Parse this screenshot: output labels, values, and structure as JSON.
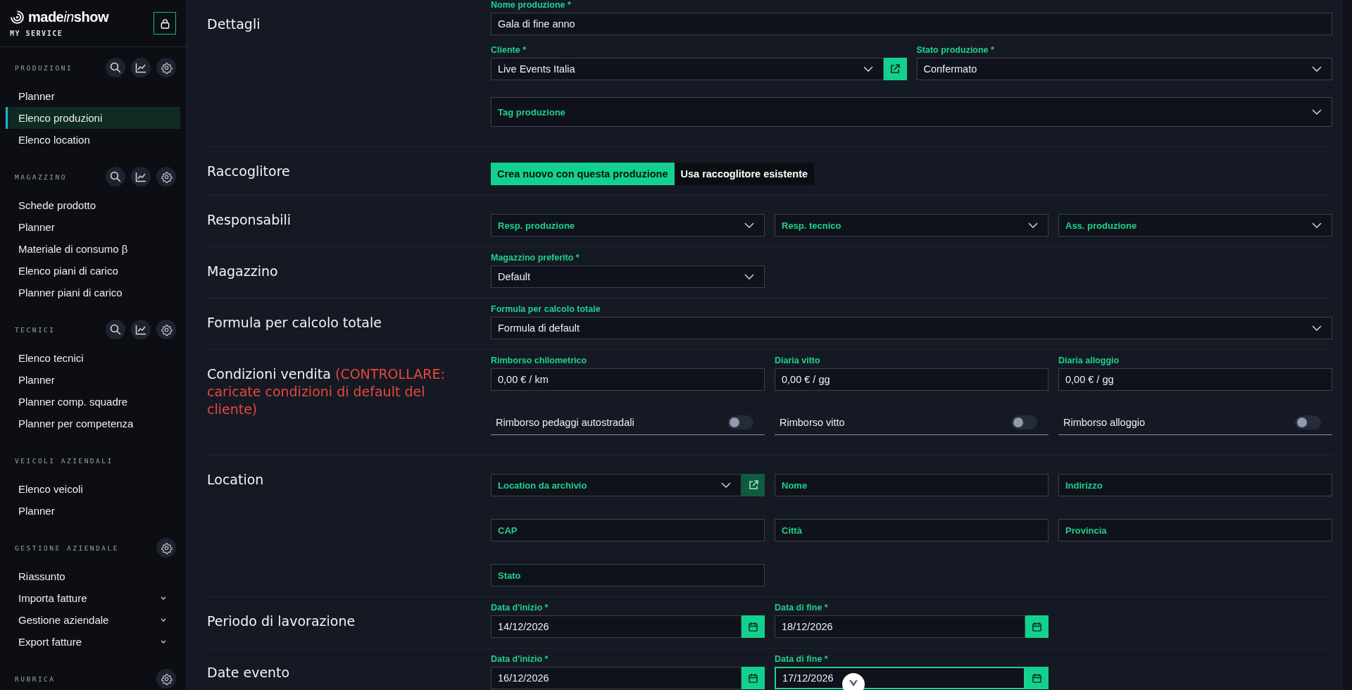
{
  "sidebar": {
    "logo": [
      {
        "text": "made",
        "italic": false
      },
      {
        "text": "in",
        "italic": true
      },
      {
        "text": "show",
        "italic": false
      }
    ],
    "subtitle": "MY SERVICE",
    "sections": [
      {
        "title": "PRODUZIONI",
        "actions": [
          {
            "kind": "search"
          },
          {
            "kind": "chart"
          },
          {
            "kind": "settings"
          }
        ],
        "items": [
          {
            "label": "Planner",
            "selected": false
          },
          {
            "label": "Elenco produzioni",
            "selected": true
          },
          {
            "label": "Elenco location",
            "selected": false
          }
        ]
      },
      {
        "title": "MAGAZZINO",
        "actions": [
          {
            "kind": "search"
          },
          {
            "kind": "chart"
          },
          {
            "kind": "settings"
          }
        ],
        "items": [
          {
            "label": "Schede prodotto",
            "selected": false
          },
          {
            "label": "Planner",
            "selected": false
          },
          {
            "label": "Materiale di consumo β",
            "selected": false
          },
          {
            "label": "Elenco piani di carico",
            "selected": false
          },
          {
            "label": "Planner piani di carico",
            "selected": false
          }
        ]
      },
      {
        "title": "TECNICI",
        "actions": [
          {
            "kind": "search"
          },
          {
            "kind": "chart"
          },
          {
            "kind": "settings"
          }
        ],
        "items": [
          {
            "label": "Elenco tecnici",
            "selected": false
          },
          {
            "label": "Planner",
            "selected": false
          },
          {
            "label": "Planner comp. squadre",
            "selected": false
          },
          {
            "label": "Planner per competenza",
            "selected": false
          }
        ]
      },
      {
        "title": "VEICOLI AZIENDALI",
        "items": [
          {
            "label": "Elenco veicoli",
            "selected": false
          },
          {
            "label": "Planner",
            "selected": false
          }
        ]
      },
      {
        "title": "GESTIONE AZIENDALE",
        "actions": [
          {
            "kind": "settings"
          }
        ],
        "items": [
          {
            "label": "Riassunto",
            "selected": false
          },
          {
            "label": "Importa fatture",
            "selected": false,
            "expandable": true
          },
          {
            "label": "Gestione aziendale",
            "selected": false,
            "expandable": true
          },
          {
            "label": "Export fatture",
            "selected": false,
            "expandable": true
          }
        ]
      },
      {
        "title": "RUBRICA",
        "actions": [
          {
            "kind": "settings"
          }
        ]
      }
    ]
  },
  "form": {
    "sections": [
      {
        "title": "Dettagli",
        "rows": [
          [
            {
              "kind": "text",
              "label": "Nome produzione *",
              "value": "Gala di fine anno"
            }
          ],
          [
            {
              "kind": "select",
              "label": "Cliente *",
              "value": "Live Events Italia",
              "link_button": {
                "disabled": false
              }
            },
            {
              "kind": "select",
              "label": "Stato produzione *",
              "value": "Confermato"
            }
          ],
          [
            {
              "kind": "select",
              "label": "Tag produzione"
            }
          ]
        ]
      },
      {
        "title": "Raccoglitore",
        "rows": [
          [
            {
              "kind": "segmented",
              "options": [
                {
                  "label": "Crea nuovo con questa produzione",
                  "selected": true
                },
                {
                  "label": "Usa raccoglitore esistente",
                  "selected": false
                }
              ]
            }
          ]
        ]
      },
      {
        "title": "Responsabili",
        "rows": [
          [
            {
              "kind": "select",
              "label": "Resp. produzione"
            },
            {
              "kind": "select",
              "label": "Resp. tecnico"
            },
            {
              "kind": "select",
              "label": "Ass. produzione"
            }
          ]
        ]
      },
      {
        "title": "Magazzino",
        "rows": [
          [
            {
              "kind": "select",
              "label": "Magazzino preferito *",
              "value": "Default"
            }
          ]
        ]
      },
      {
        "title": "Formula per calcolo totale",
        "rows": [
          [
            {
              "kind": "select",
              "label": "Formula per calcolo totale",
              "value": "Formula di default"
            }
          ]
        ]
      },
      {
        "title": "Condizioni vendita",
        "note": "(CONTROLLARE: caricate condizioni di default del cliente)",
        "rows": [
          [
            {
              "kind": "text",
              "label": "Rimborso chilometrico",
              "value": "0,00 € / km"
            },
            {
              "kind": "text",
              "label": "Diaria vitto",
              "value": "0,00 € / gg"
            },
            {
              "kind": "text",
              "label": "Diaria alloggio",
              "value": "0,00 € / gg"
            }
          ],
          [
            {
              "kind": "toggle",
              "label": "Rimborso pedaggi autostradali",
              "on": false
            },
            {
              "kind": "toggle",
              "label": "Rimborso vitto",
              "on": false
            },
            {
              "kind": "toggle",
              "label": "Rimborso alloggio",
              "on": false
            }
          ]
        ]
      },
      {
        "title": "Location",
        "rows": [
          [
            {
              "kind": "select",
              "label": "Location da archivio",
              "link_button": {
                "disabled": true
              }
            },
            {
              "kind": "text",
              "label": "Nome"
            },
            {
              "kind": "text",
              "label": "Indirizzo"
            }
          ],
          [
            {
              "kind": "text",
              "label": "CAP"
            },
            {
              "kind": "text",
              "label": "Città"
            },
            {
              "kind": "text",
              "label": "Provincia"
            }
          ],
          [
            {
              "kind": "text",
              "label": "Stato"
            }
          ]
        ]
      },
      {
        "title": "Periodo di lavorazione",
        "rows": [
          [
            {
              "kind": "date",
              "label": "Data d'inizio *",
              "value": "14/12/2026",
              "focused": false
            },
            {
              "kind": "date",
              "label": "Data di fine *",
              "value": "18/12/2026",
              "focused": false
            }
          ]
        ]
      },
      {
        "title": "Date evento",
        "rows": [
          [
            {
              "kind": "date",
              "label": "Data d'inizio *",
              "value": "16/12/2026",
              "focused": false
            },
            {
              "kind": "date",
              "label": "Data di fine *",
              "value": "17/12/2026",
              "focused": true
            }
          ]
        ]
      }
    ]
  }
}
